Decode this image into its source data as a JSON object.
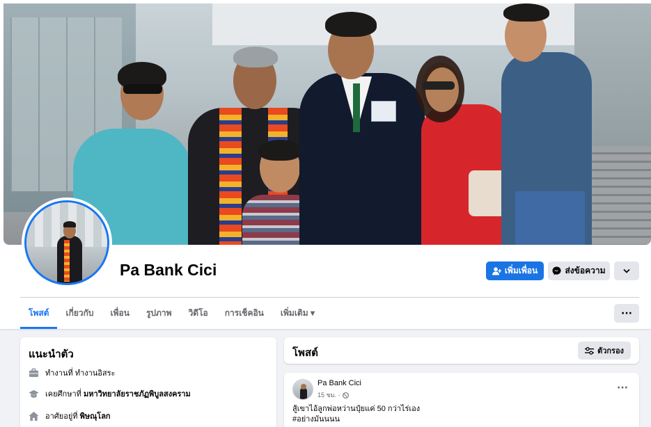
{
  "profile": {
    "name": "Pa Bank Cici",
    "actions": {
      "add_friend": "เพิ่มเพื่อน",
      "message": "ส่งข้อความ",
      "more": "⌄"
    }
  },
  "tabs": [
    {
      "label": "โพสต์"
    },
    {
      "label": "เกี่ยวกับ"
    },
    {
      "label": "เพื่อน"
    },
    {
      "label": "รูปภาพ"
    },
    {
      "label": "วิดีโอ"
    },
    {
      "label": "การเช็คอิน"
    },
    {
      "label": "เพิ่มเติม ▾"
    }
  ],
  "tab_more_dots": "···",
  "intro": {
    "title": "แนะนำตัว",
    "items": [
      {
        "icon": "briefcase-icon",
        "prefix": "ทำงานที่ ",
        "value": "ทำงานอิสระ"
      },
      {
        "icon": "graduation-cap-icon",
        "prefix": "เคยศึกษาที่ ",
        "value": "มหาวิทยาลัยราชภัฏพิบูลสงคราม"
      },
      {
        "icon": "home-icon",
        "prefix": "อาศัยอยู่ที่ ",
        "value": "พิษณุโลก"
      }
    ]
  },
  "posts_section": {
    "title": "โพสต์",
    "filter_label": "ตัวกรอง"
  },
  "post": {
    "author": "Pa Bank Cici",
    "time": "15 ชม. ·",
    "audience_icon": "globe-icon",
    "line1": "สู้เขาไอ้ลูกพ่อหว่านปุ๋ยแค่ 50 กว่าไร่เอง",
    "line2": "#อย่างมันนนน",
    "more": "···"
  },
  "colors": {
    "accent": "#1877f2",
    "page_bg": "#f0f2f5",
    "secondary_button": "#e4e6eb"
  }
}
